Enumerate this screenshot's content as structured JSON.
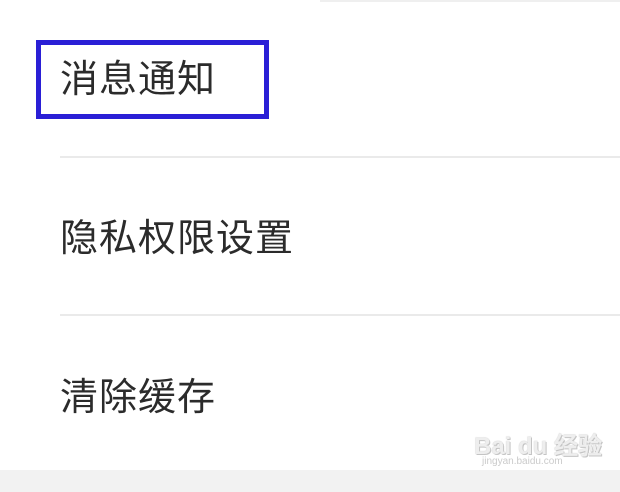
{
  "settings": {
    "items": [
      {
        "label": "消息通知",
        "highlighted": true
      },
      {
        "label": "隐私权限设置",
        "highlighted": false
      },
      {
        "label": "清除缓存",
        "highlighted": false
      }
    ]
  },
  "highlight": {
    "color": "#2a1fd6"
  },
  "watermark": {
    "logo_text": "Bai du 经验",
    "url_text": "jingyan.baidu.com"
  }
}
